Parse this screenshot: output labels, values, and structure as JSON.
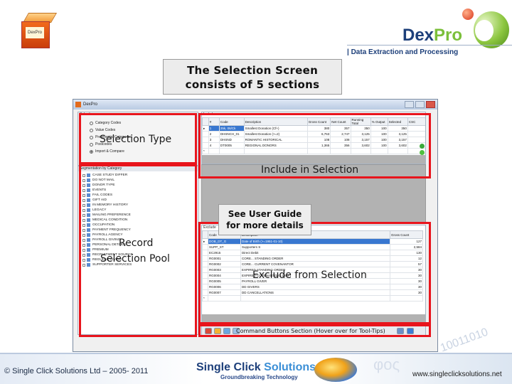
{
  "branding": {
    "logo_dex": "Dex",
    "logo_pro": "Pro",
    "tagline": "| Data Extraction and Processing",
    "box_label": "DexPro"
  },
  "title": {
    "line1": "The Selection Screen",
    "line2": "consists of 5 sections"
  },
  "window": {
    "title": "DexPro"
  },
  "selection": {
    "caption": "Selection",
    "options": [
      "Category Codes",
      "Value Codes",
      "Preferential Categories",
      "Postcodes",
      "Import & Compare"
    ],
    "selected_index": 4
  },
  "pool": {
    "caption": "Segmentation by Category",
    "items": [
      "CASE STUDY DIFFER",
      "DO NOT MAIL",
      "DONOR TYPE",
      "EVENTS",
      "FAIL CODES",
      "GIFT AID",
      "IN MEMORY HISTORY",
      "LEGACY",
      "MAILING PREFERENCE",
      "MEDICAL CONDITION",
      "OCCUPATION",
      "PAYMENT FREQUENCY",
      "PAYROLL AGENCY",
      "PAYROLL GIVING",
      "PERSONAL DETAILS",
      "PREMIUM",
      "RECRUITMENT SOURCE",
      "REGULAR GIVING",
      "SUPPORTER SERVICES"
    ]
  },
  "include": {
    "caption": "Include",
    "columns": [
      "#",
      "Code",
      "Description",
      "Gross Count",
      "Net Count",
      "Running Total",
      "% Output",
      "Selected",
      "CSC"
    ],
    "rows": [
      [
        "1",
        "25k, 06/Ck",
        "Smallest Donation (Cf+)",
        "380",
        "357",
        "350",
        "100",
        "350",
        ""
      ],
      [
        "2",
        "DHSNCH_01",
        "Smallest Donation (>=2)",
        "6,763",
        "2,747",
        "3,125",
        "100",
        "3,125",
        ""
      ],
      [
        "3",
        "DHSND",
        "ROMANTIC HISTORICAL",
        "108",
        "108",
        "3,157",
        "100",
        "3,157",
        ""
      ],
      [
        "4",
        "DT0005",
        "REGIONAL DONORS",
        "1,365",
        "356",
        "3,602",
        "100",
        "3,602",
        ""
      ]
    ],
    "selected_row": 0,
    "new_row_marker": "*"
  },
  "exclude": {
    "caption": "Exclude",
    "columns": [
      "Code",
      "Description",
      "Gross Count"
    ],
    "rows": [
      [
        "DOB_DT_G",
        "Date of Birth (>=1951-01-10)",
        "127"
      ],
      [
        "SUPP_ST",
        "Supporters S",
        "2,584"
      ],
      [
        "EC2915",
        "Direct Debit",
        "130"
      ],
      [
        "RG0001",
        "CORE... STANDING ORDER",
        "12"
      ],
      [
        "RG0002",
        "CORE... CURRENT COVENANTOR",
        "57"
      ],
      [
        "RG0003",
        "EXPIRED STANDING ORDER",
        "30"
      ],
      [
        "RG0004",
        "EXPIRED COVENANTORS (BHF)",
        "30"
      ],
      [
        "RG0005",
        "PAYROLL GIVER",
        "30"
      ],
      [
        "RG0006",
        "DD GIVERS",
        "30"
      ],
      [
        "RG0007",
        "DD CANCELLATIONS",
        "30"
      ]
    ],
    "selected_row": 0,
    "new_row_marker": "*"
  },
  "annotations": {
    "selection_type": "Selection Type",
    "include": "Include in Selection",
    "record_pool_line1": "Record",
    "record_pool_line2": "Selection Pool",
    "exclude": "Exclude from Selection",
    "command": "Command Buttons Section (Hover over for Tool-Tips)",
    "guide_line1": "See User Guide",
    "guide_line2": "for more details"
  },
  "footer": {
    "copyright": "© Single Click Solutions Ltd – 2005- 2011",
    "company_part1": "Single Click ",
    "company_part2": "Solutions",
    "company_tag": "Groundbreaking Technology",
    "website": "www.singleclicksolutions.net",
    "binary_deco": "10011010",
    "phi_deco": "φoς"
  },
  "colors": {
    "highlight_frame": "#e8141c",
    "brand_blue": "#1d3f7a",
    "brand_green": "#7bbf3a",
    "grid_selected": "#3877d0"
  }
}
